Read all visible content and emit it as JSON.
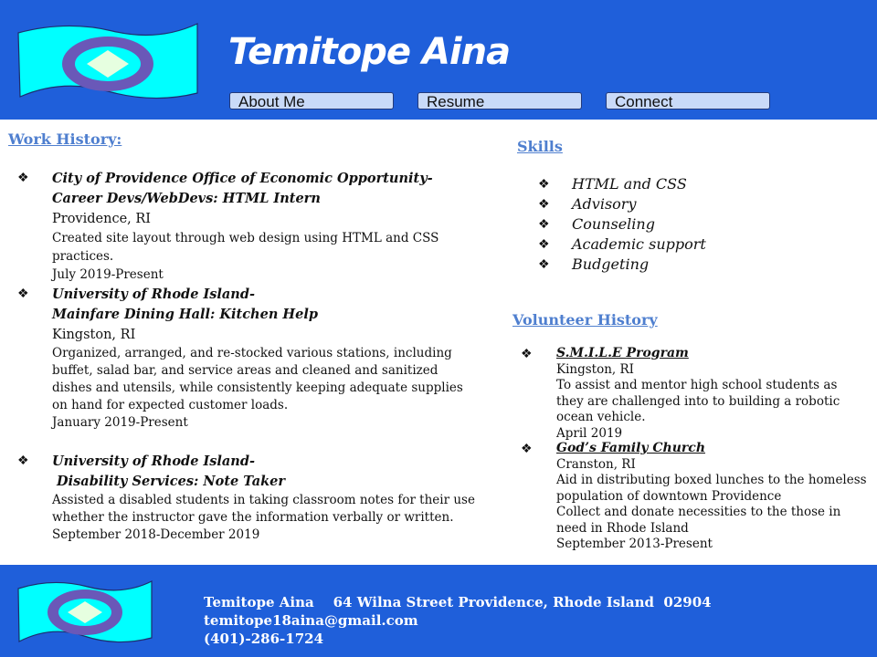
{
  "header": {
    "title": "Temitope Aina",
    "nav": [
      "About Me",
      "Resume",
      "Connect"
    ]
  },
  "work": {
    "heading": "Work History:",
    "jobs": [
      {
        "title1": "City of Providence Office of Economic Opportunity-",
        "title2": "Career Devs/WebDevs: HTML Intern",
        "location": "Providence, RI",
        "description": "Created site layout through web design using HTML and CSS practices.",
        "dates": "July 2019-Present"
      },
      {
        "title1": "University of Rhode Island-",
        "title2": "Mainfare Dining Hall: Kitchen Help",
        "location": "Kingston, RI",
        "description": "Organized, arranged, and re-stocked various stations, including buffet, salad bar, and service areas and cleaned and sanitized dishes and utensils, while consistently keeping adequate supplies on hand for expected customer loads.",
        "dates": "January 2019-Present"
      },
      {
        "title1": "University of Rhode Island-",
        "title2": " Disability Services: Note Taker",
        "location": "",
        "description": "Assisted a disabled students in taking classroom notes for their use whether the instructor gave the information verbally or written.",
        "dates": "September 2018-December 2019"
      }
    ]
  },
  "skills": {
    "heading": "Skills",
    "items": [
      "HTML and CSS",
      "Advisory",
      "Counseling",
      "Academic support",
      "Budgeting"
    ]
  },
  "volunteer": {
    "heading": "Volunteer History",
    "items": [
      {
        "name": "S.M.I.L.E ",
        "suffix": "Program",
        "location": "Kingston, RI",
        "description": "To assist and mentor high school students as they are challenged into to building a robotic ocean vehicle.",
        "dates": "April 2019"
      },
      {
        "name": "God’s Family Church",
        "suffix": "",
        "location": "Cranston, RI",
        "description": "Aid in distributing boxed lunches to the homeless population of downtown Providence",
        "description2": "Collect and donate necessities to the those in need in Rhode Island",
        "dates": "September 2013-Present"
      }
    ]
  },
  "footer": {
    "line1": "Temitope Aina    64 Wilna Street Providence, Rhode Island  02904",
    "email": "temitope18aina@gmail.com",
    "phone": "(401)-286-1724"
  },
  "icons": {
    "bullet": "❖",
    "logo": "flag-logo-icon"
  },
  "colors": {
    "header_bg": "#1f5fda",
    "flag": "#00ffff",
    "ring": "#6a58b8",
    "diamond": "#e6ffe0",
    "section_heading": "#4f7fcf",
    "nav_button": "#c9daf8"
  }
}
